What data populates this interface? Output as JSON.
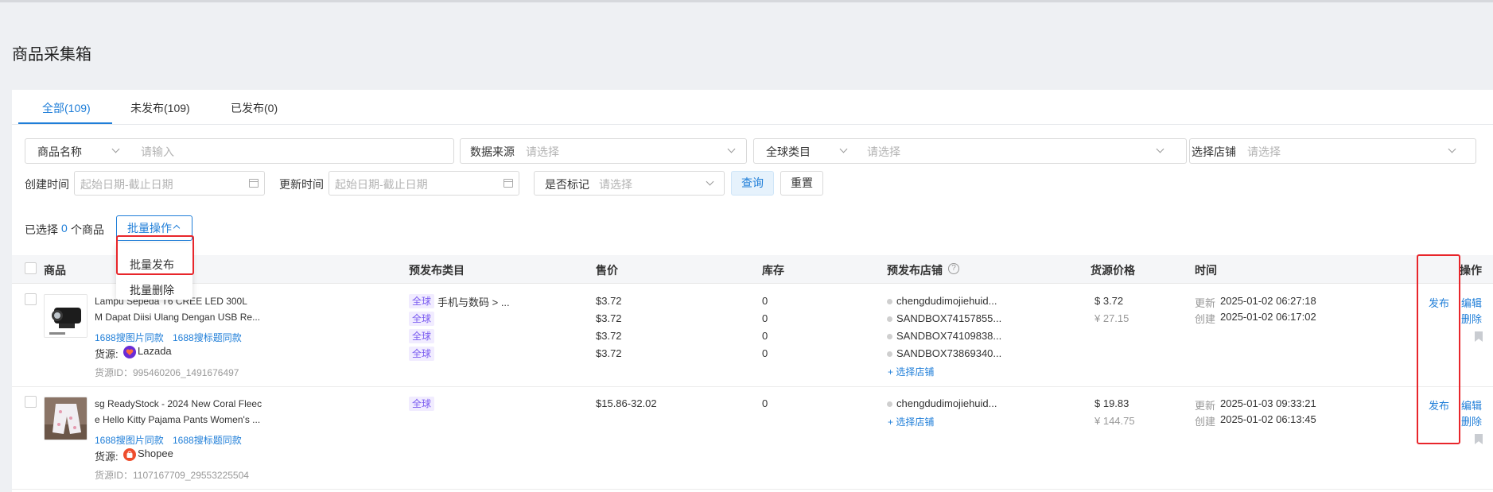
{
  "page": {
    "title": "商品采集箱"
  },
  "tabs": [
    {
      "label": "全部(109)",
      "active": true
    },
    {
      "label": "未发布(109)",
      "active": false
    },
    {
      "label": "已发布(0)",
      "active": false
    }
  ],
  "filters": {
    "product_field_select": "商品名称",
    "product_name_placeholder": "请输入",
    "data_source_label": "数据来源",
    "data_source_placeholder": "请选择",
    "category_select": "全球类目",
    "category_placeholder": "请选择",
    "store_label": "选择店铺",
    "store_placeholder": "请选择",
    "created_time_label": "创建时间",
    "created_time_placeholder": "起始日期-截止日期",
    "updated_time_label": "更新时间",
    "updated_time_placeholder": "起始日期-截止日期",
    "marked_label": "是否标记",
    "marked_placeholder": "请选择",
    "query_button": "查询",
    "reset_button": "重置"
  },
  "batch": {
    "selected_prefix": "已选择",
    "selected_count": "0",
    "selected_suffix": "个商品",
    "batch_button": "批量操作",
    "menu": [
      "批量发布",
      "批量删除"
    ]
  },
  "table": {
    "headers": {
      "product": "商品",
      "category": "预发布类目",
      "price": "售价",
      "stock": "库存",
      "store": "预发布店铺",
      "source_price": "货源价格",
      "time": "时间",
      "actions": "操作"
    },
    "rows": [
      {
        "title_line1": "Lampu Sepeda T6 CREE LED 300L",
        "title_line2": "M Dapat Diisi Ulang Dengan USB Re...",
        "image_search": "1688搜图片同款",
        "title_search": "1688搜标题同款",
        "source_label": "货源:",
        "source_name": "Lazada",
        "source_id": "货源ID：995460206_1491676497",
        "category_tags": [
          "全球",
          "全球",
          "全球",
          "全球"
        ],
        "category_path": "手机与数码 > ...",
        "prices": [
          "$3.72",
          "$3.72",
          "$3.72",
          "$3.72"
        ],
        "stocks": [
          "0",
          "0",
          "0",
          "0"
        ],
        "stores": [
          "chengdudimojiehuid...",
          "SANDBOX74157855...",
          "SANDBOX74109838...",
          "SANDBOX73869340..."
        ],
        "select_store": "+ 选择店铺",
        "source_price_usd": "$ 3.72",
        "source_price_cny": "¥ 27.15",
        "updated_label": "更新",
        "updated": "2025-01-02 06:27:18",
        "created_label": "创建",
        "created": "2025-01-02 06:17:02",
        "publish": "发布",
        "edit": "编辑",
        "delete": "删除"
      },
      {
        "title_line1": "sg ReadyStock - 2024 New Coral Fleec",
        "title_line2": "e Hello Kitty Pajama Pants Women's ...",
        "image_search": "1688搜图片同款",
        "title_search": "1688搜标题同款",
        "source_label": "货源:",
        "source_name": "Shopee",
        "source_id": "货源ID：1107167709_29553225504",
        "category_tags": [
          "全球"
        ],
        "prices": [
          "$15.86-32.02"
        ],
        "stocks": [
          "0"
        ],
        "stores": [
          "chengdudimojiehuid..."
        ],
        "select_store": "+ 选择店铺",
        "source_price_usd": "$ 19.83",
        "source_price_cny": "¥ 144.75",
        "updated_label": "更新",
        "updated": "2025-01-03 09:33:21",
        "created_label": "创建",
        "created": "2025-01-02 06:13:45",
        "publish": "发布",
        "edit": "编辑",
        "delete": "删除"
      }
    ]
  },
  "colors": {
    "accent": "#1f7ed8",
    "tag_bg": "#f1ecff",
    "tag_text": "#7a5bf0",
    "highlight": "#e8262b"
  }
}
